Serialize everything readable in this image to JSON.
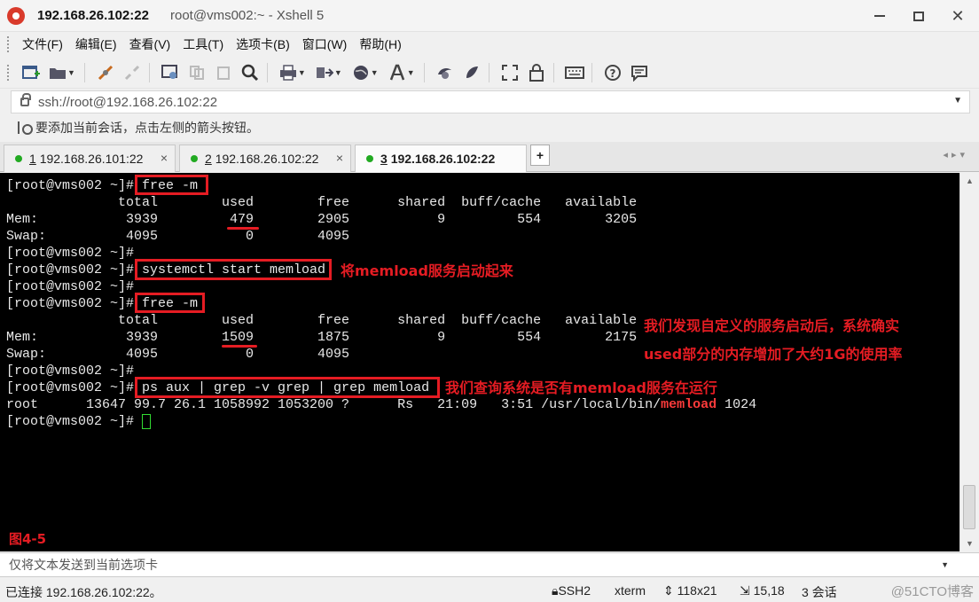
{
  "window": {
    "host_title": "192.168.26.102:22",
    "title_rest": "root@vms002:~ - Xshell 5"
  },
  "menu": [
    "文件(F)",
    "编辑(E)",
    "查看(V)",
    "工具(T)",
    "选项卡(B)",
    "窗口(W)",
    "帮助(H)"
  ],
  "address": {
    "url": "ssh://root@192.168.26.102:22"
  },
  "hint": {
    "text": "要添加当前会话，点击左侧的箭头按钮。"
  },
  "tabs": [
    {
      "num": "1",
      "label": "192.168.26.101:22"
    },
    {
      "num": "2",
      "label": "192.168.26.102:22"
    },
    {
      "num": "3",
      "label": "192.168.26.102:22"
    }
  ],
  "terminal": {
    "lines": [
      "[root@vms002 ~]# free -m",
      "              total        used        free      shared  buff/cache   available",
      "Mem:           3939         479        2905           9         554        3205",
      "Swap:          4095           0        4095",
      "[root@vms002 ~]#",
      "[root@vms002 ~]# systemctl start memload",
      "[root@vms002 ~]#",
      "[root@vms002 ~]# free -m",
      "              total        used        free      shared  buff/cache   available",
      "Mem:           3939        1509        1875           9         554        2175",
      "Swap:          4095           0        4095",
      "[root@vms002 ~]#",
      "[root@vms002 ~]# ps aux | grep -v grep | grep memload",
      "root      13647 99.7 26.1 1058992 1053200 ?      Rs   21:09   3:51 /usr/local/bin/",
      "[root@vms002 ~]# "
    ],
    "highlight_word": "memload",
    "after_highlight": " 1024"
  },
  "annotations": {
    "start_service": "将memload服务启动起来",
    "memory_note_1": "我们发现自定义的服务启动后，系统确实",
    "memory_note_2": "used部分的内存增加了大约1G的使用率",
    "query_note": "我们查询系统是否有memload服务在运行",
    "figure_label": "图4-5"
  },
  "sendbar": {
    "text": "仅将文本发送到当前选项卡"
  },
  "status": {
    "connected": "已连接 192.168.26.102:22。",
    "protocol": "SSH2",
    "term": "xterm",
    "size": "118x21",
    "cursor": "15,18",
    "sessions": "3 会话",
    "watermark": "@51CTO博客"
  },
  "colors": {
    "annotation_red": "#e51c23",
    "terminal_bg": "#000000",
    "status_dot": "#22aa22"
  }
}
